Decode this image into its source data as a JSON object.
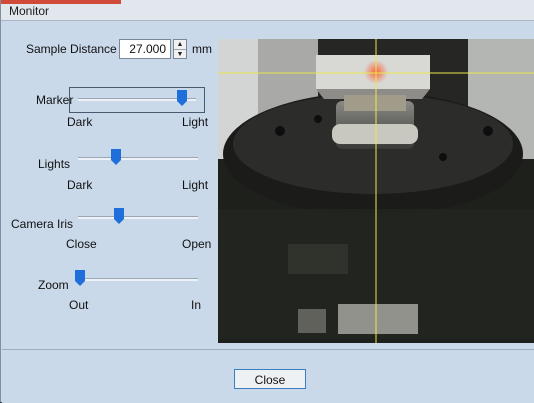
{
  "window": {
    "title": "Monitor"
  },
  "sample_distance": {
    "label": "Sample Distance",
    "value": "27.000",
    "unit": "mm"
  },
  "sliders": {
    "marker": {
      "label": "Marker",
      "min_label": "Dark",
      "max_label": "Light",
      "level": 0.88
    },
    "lights": {
      "label": "Lights",
      "min_label": "Dark",
      "max_label": "Light",
      "level": 0.32
    },
    "camera_iris": {
      "label": "Camera Iris",
      "min_label": "Close",
      "max_label": "Open",
      "level": 0.34
    },
    "zoom": {
      "label": "Zoom",
      "min_label": "Out",
      "max_label": "In",
      "level": 0.02
    }
  },
  "footer": {
    "close_label": "Close"
  },
  "colors": {
    "window_bg": "#c9d9ea",
    "thumb": "#1e6fd9",
    "crosshair": "#e8e84a",
    "title_accent": "#d04a3a"
  }
}
